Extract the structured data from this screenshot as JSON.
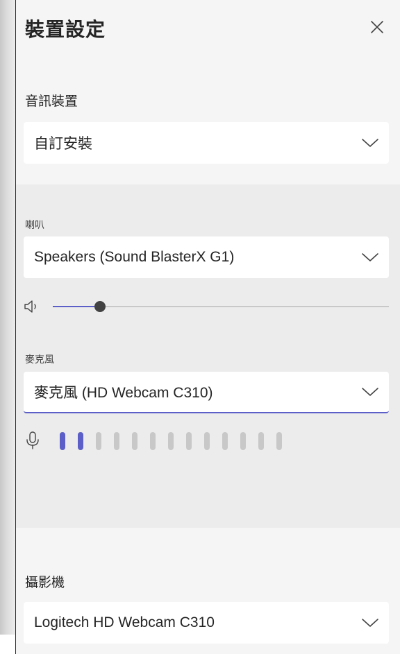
{
  "panel": {
    "title": "裝置設定",
    "close_icon": "close-icon"
  },
  "audio_device": {
    "label": "音訊裝置",
    "value": "自訂安裝"
  },
  "speaker": {
    "label": "喇叭",
    "value": "Speakers (Sound BlasterX G1)",
    "volume_fraction": 0.14,
    "icon": "speaker-icon"
  },
  "microphone": {
    "label": "麥克風",
    "value": "麥克風 (HD Webcam C310)",
    "icon": "microphone-icon",
    "meter_total": 13,
    "meter_active": 2
  },
  "camera": {
    "label": "攝影機",
    "value": "Logitech HD Webcam C310"
  },
  "colors": {
    "accent": "#5b5fc7",
    "panel_bg": "#f5f5f5",
    "band_bg": "#ececec",
    "inactive": "#c8c8c8"
  }
}
